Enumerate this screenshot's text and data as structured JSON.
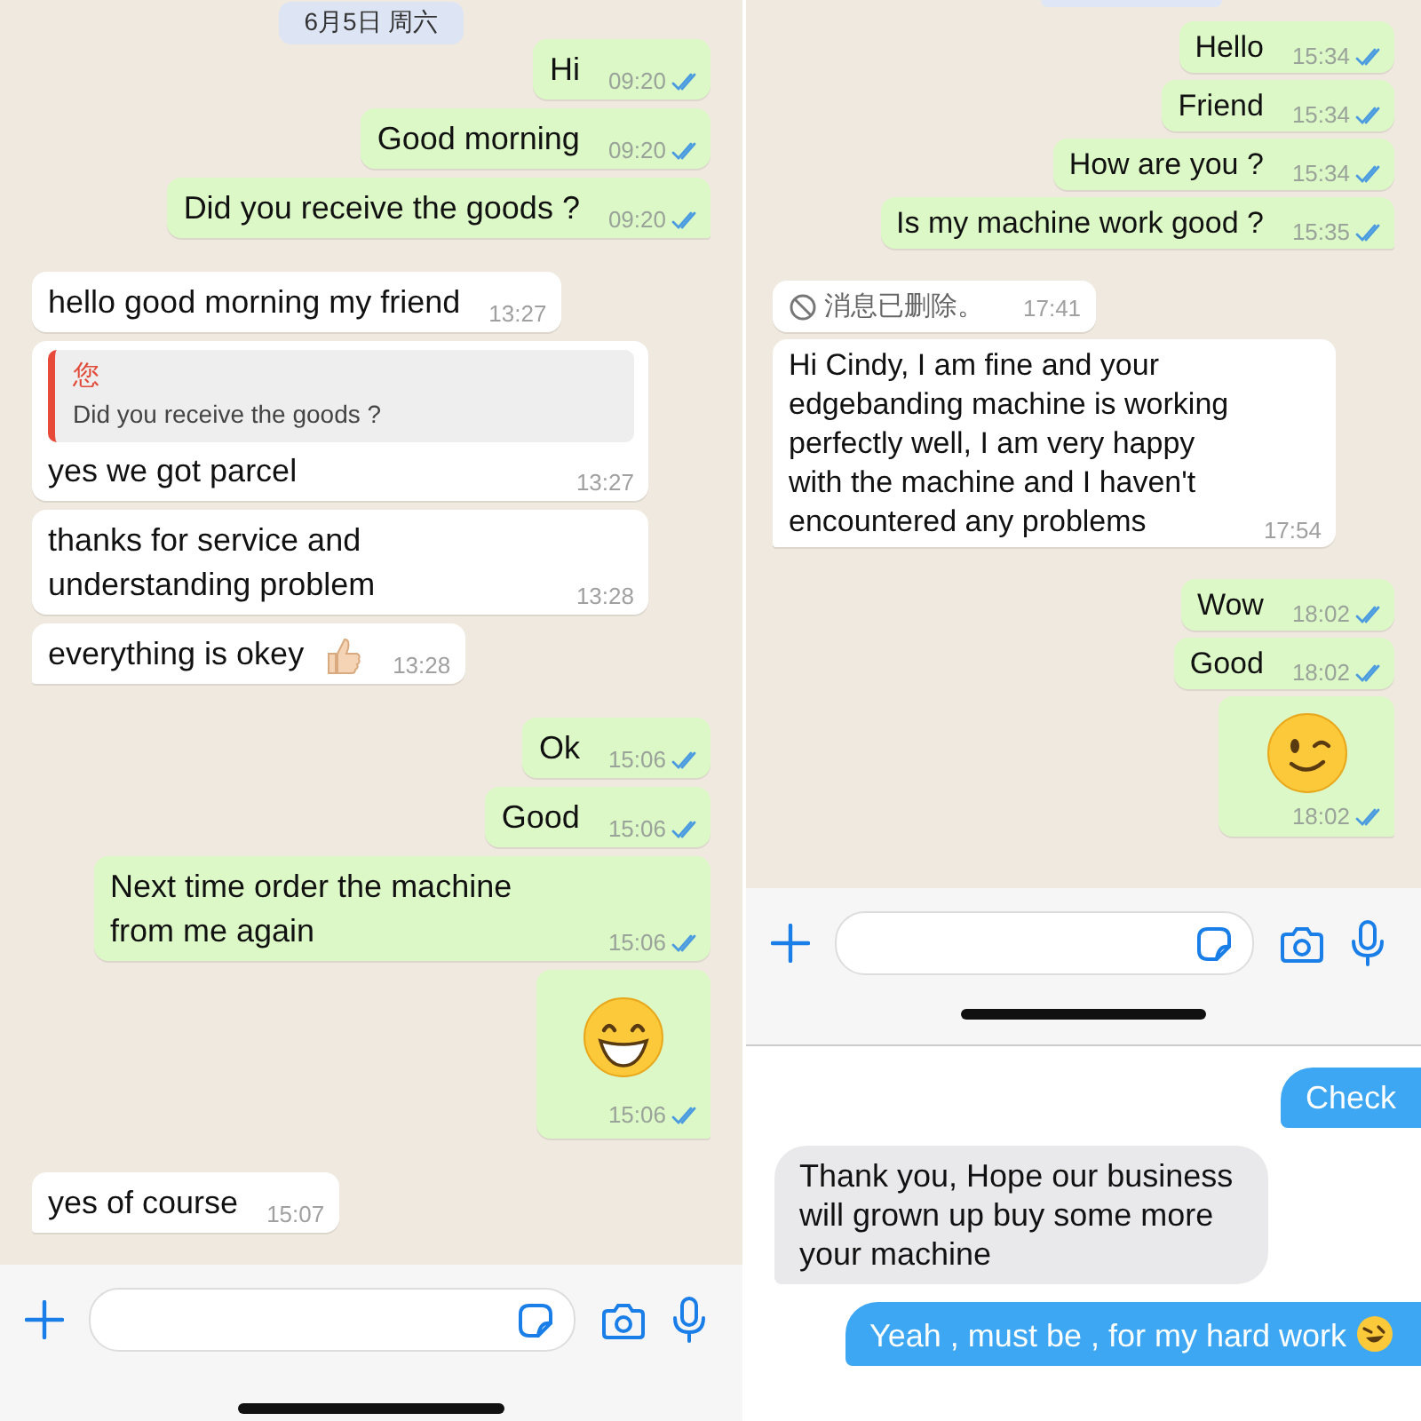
{
  "left_chat": {
    "date_chip": "6月5日 周六",
    "messages": [
      {
        "kind": "text",
        "outgoing": true,
        "text": "Hi",
        "time": "09:20",
        "read": true
      },
      {
        "kind": "text",
        "outgoing": true,
        "text": "Good morning",
        "time": "09:20",
        "read": true
      },
      {
        "kind": "text",
        "outgoing": true,
        "text": "Did you receive the goods ?",
        "time": "09:20",
        "read": true
      },
      {
        "kind": "text",
        "outgoing": false,
        "text": "hello good morning my friend",
        "time": "13:27"
      },
      {
        "kind": "quote",
        "outgoing": false,
        "quote_author": "您",
        "quote_text": "Did you receive the goods ?",
        "text": "yes we got parcel",
        "time": "13:27"
      },
      {
        "kind": "text",
        "outgoing": false,
        "text": "thanks for service and understanding problem",
        "time": "13:28"
      },
      {
        "kind": "thumbs",
        "outgoing": false,
        "text": "everything is okey",
        "time": "13:28"
      },
      {
        "kind": "text",
        "outgoing": true,
        "text": "Ok",
        "time": "15:06",
        "read": true
      },
      {
        "kind": "text",
        "outgoing": true,
        "text": "Good",
        "time": "15:06",
        "read": true
      },
      {
        "kind": "text",
        "outgoing": true,
        "text": "Next time order the machine from me again",
        "time": "15:06",
        "read": true
      },
      {
        "kind": "grin",
        "outgoing": true,
        "time": "15:06",
        "read": true
      },
      {
        "kind": "text",
        "outgoing": false,
        "text": "yes of course",
        "time": "15:07"
      }
    ]
  },
  "right_chat": {
    "messages": [
      {
        "kind": "text",
        "outgoing": true,
        "text": "Hello",
        "time": "15:34",
        "read": true
      },
      {
        "kind": "text",
        "outgoing": true,
        "text": "Friend",
        "time": "15:34",
        "read": true
      },
      {
        "kind": "text",
        "outgoing": true,
        "text": "How are you ?",
        "time": "15:34",
        "read": true
      },
      {
        "kind": "text",
        "outgoing": true,
        "text": "Is my  machine work good ?",
        "time": "15:35",
        "read": true
      },
      {
        "kind": "deleted",
        "outgoing": false,
        "text": "消息已删除。",
        "time": "17:41"
      },
      {
        "kind": "text",
        "outgoing": false,
        "text": "Hi Cindy, I am fine and your edgebanding machine is working perfectly well, I am very happy with the machine and I haven't encountered any problems",
        "time": "17:54"
      },
      {
        "kind": "text",
        "outgoing": true,
        "text": "Wow",
        "time": "18:02",
        "read": true
      },
      {
        "kind": "text",
        "outgoing": true,
        "text": "Good",
        "time": "18:02",
        "read": true
      },
      {
        "kind": "wink",
        "outgoing": true,
        "time": "18:02",
        "read": true
      }
    ]
  },
  "sms_chat": {
    "messages": [
      {
        "kind": "text",
        "outgoing": true,
        "text": "Check"
      },
      {
        "kind": "text",
        "outgoing": false,
        "text": "Thank you, Hope our business will grown up buy some more your machine"
      },
      {
        "kind": "laugh",
        "outgoing": true,
        "text": "Yeah , must be , for my hard work"
      }
    ]
  }
}
